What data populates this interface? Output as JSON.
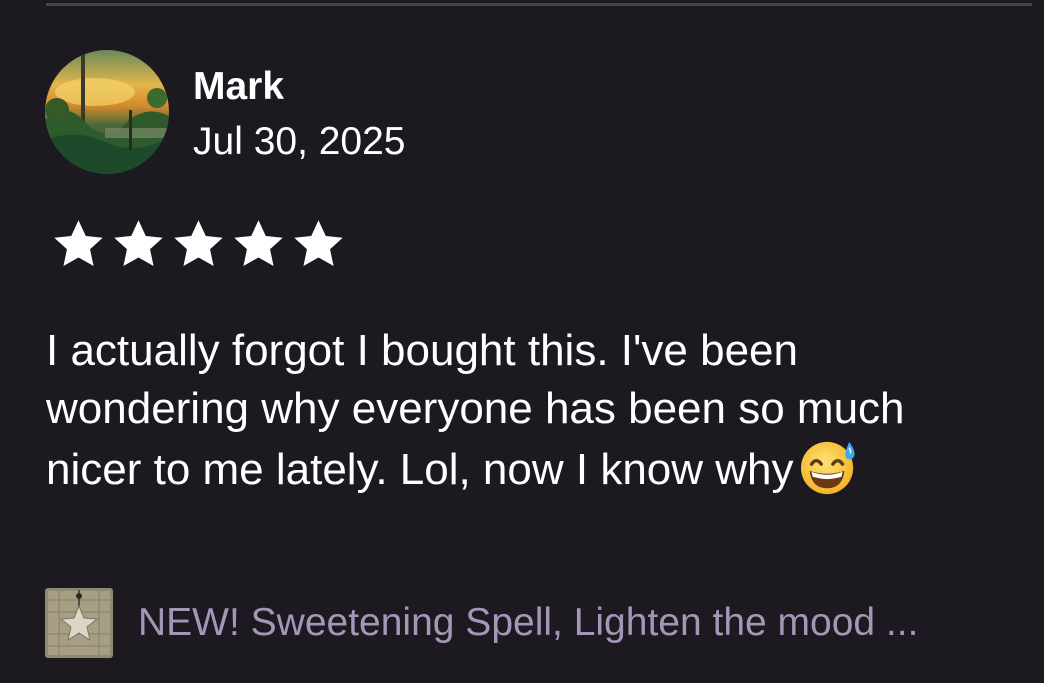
{
  "review": {
    "reviewer_name": "Mark",
    "date": "Jul 30, 2025",
    "rating": 5,
    "rating_max": 5,
    "text": "I actually forgot I bought this. I've been wondering why everyone has been so much nicer to me lately. Lol, now I know why",
    "text_emoji": "grinning-face-with-sweat-emoji"
  },
  "product": {
    "title": "NEW! Sweetening Spell, Lighten the mood ..."
  },
  "icons": {
    "star": "star-icon",
    "avatar": "avatar-landscape-photo",
    "product_thumbnail": "product-thumbnail-image"
  },
  "colors": {
    "background": "#1c1a20",
    "text": "#ffffff",
    "product_link": "#a596b8",
    "star": "#ffffff",
    "divider": "#47414f"
  }
}
